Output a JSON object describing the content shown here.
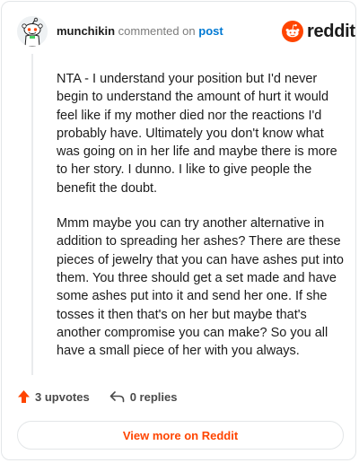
{
  "header": {
    "username": "munchikin",
    "action": "commented on",
    "post_link": "post",
    "brand": "reddit"
  },
  "comment": {
    "paragraphs": [
      "NTA - I understand your position but I'd never begin to understand the amount of hurt it would feel like if my mother died nor the reactions I'd probably have. Ultimately you don't know what was going on in her life and maybe there is more to her story. I dunno. I like to give people the benefit the doubt.",
      "Mmm maybe you can try another alternative in addition to spreading her ashes? There are these pieces of jewelry that you can have ashes put into them. You three should get a set made and have some ashes put into it and send her one. If she tosses it then that's on her but maybe that's another compromise you can make? So you all have a small piece of her with you always."
    ]
  },
  "footer": {
    "upvotes_label": "3 upvotes",
    "replies_label": "0 replies",
    "view_more_label": "View more on Reddit"
  },
  "icons": {
    "avatar": "snoo-avatar-icon",
    "logo": "reddit-logo-icon",
    "upvote": "upvote-arrow-icon",
    "reply": "reply-arrow-icon"
  },
  "colors": {
    "brand_orange": "#ff4500",
    "link_blue": "#0079d3",
    "text": "#1c1c1c",
    "muted": "#7c7c7c",
    "border": "#e3e6e8"
  }
}
